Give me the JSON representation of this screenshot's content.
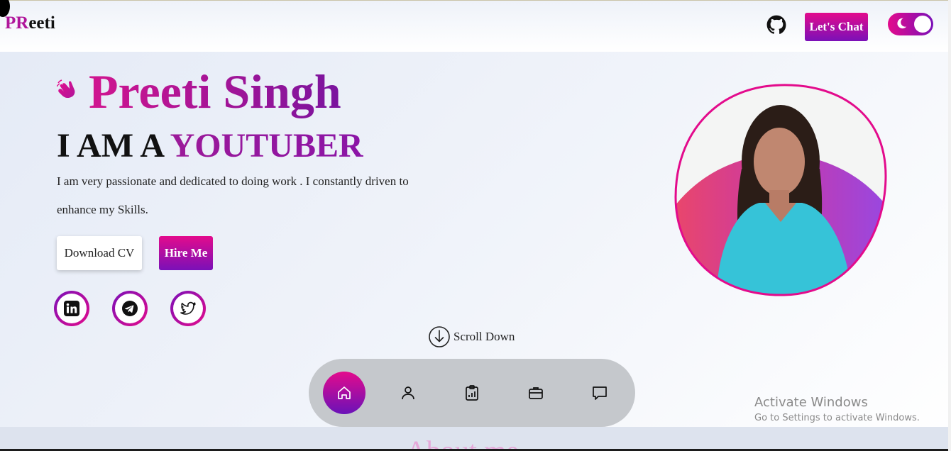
{
  "header": {
    "logo_pr": "PR",
    "logo_rest": "eeti",
    "chat_label": "Let's Chat"
  },
  "hero": {
    "name": "Preeti Singh",
    "role_prefix": "I AM A",
    "role": "YOUTUBER",
    "description": "I am very passionate and dedicated to doing work . I constantly driven to enhance my Skills.",
    "download_label": "Download CV",
    "hire_label": "Hire Me",
    "scroll_label": "Scroll Down"
  },
  "social": [
    "linkedin-icon",
    "telegram-icon",
    "twitter-icon"
  ],
  "dock": [
    "home-icon",
    "user-icon",
    "clipboard-chart-icon",
    "briefcase-icon",
    "chat-icon"
  ],
  "watermark": {
    "title": "Activate Windows",
    "subtitle": "Go to Settings to activate Windows."
  },
  "section": {
    "about_title": "About me"
  },
  "colors": {
    "accent_pink": "#e30b8c",
    "accent_purple": "#7a10b8",
    "dock_bg": "#c5c8cc"
  }
}
